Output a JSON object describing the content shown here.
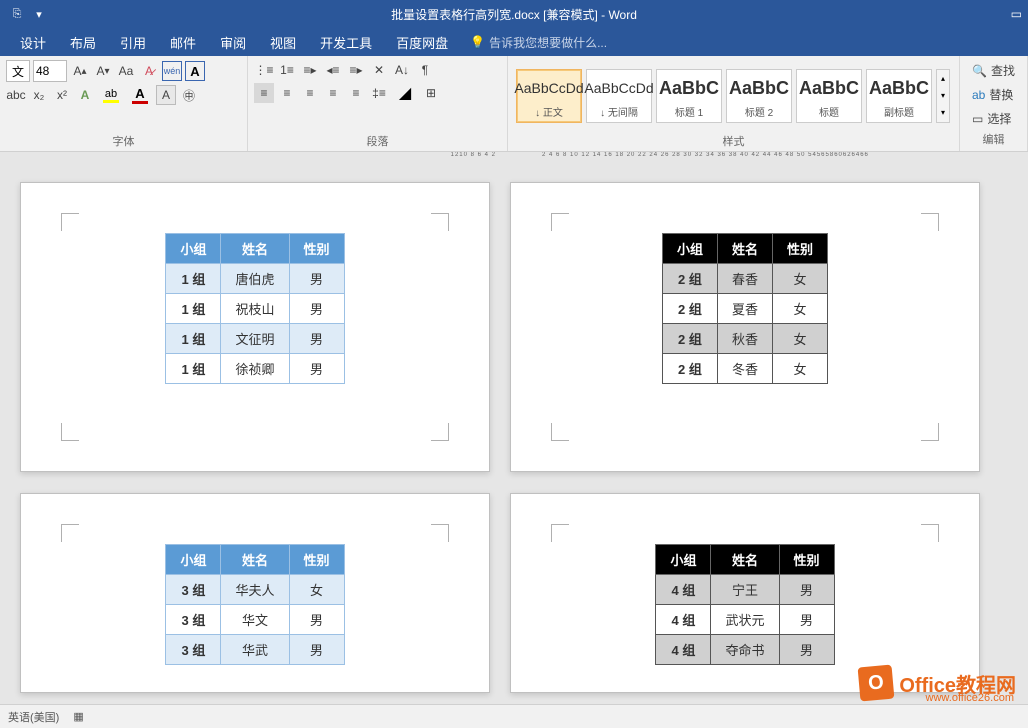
{
  "title": "批量设置表格行高列宽.docx [兼容模式] - Word",
  "tabs": [
    "设计",
    "布局",
    "引用",
    "邮件",
    "审阅",
    "视图",
    "开发工具",
    "百度网盘"
  ],
  "tellme": "告诉我您想要做什么...",
  "font_size": "48",
  "font_combo": "文",
  "groups": {
    "font": "字体",
    "paragraph": "段落",
    "styles": "样式",
    "editing": "编辑"
  },
  "styles": [
    {
      "preview": "AaBbCcDd",
      "name": "↓ 正文",
      "big": false,
      "sel": true
    },
    {
      "preview": "AaBbCcDd",
      "name": "↓ 无间隔",
      "big": false,
      "sel": false
    },
    {
      "preview": "AaBbC",
      "name": "标题 1",
      "big": true,
      "sel": false
    },
    {
      "preview": "AaBbC",
      "name": "标题 2",
      "big": true,
      "sel": false
    },
    {
      "preview": "AaBbC",
      "name": "标题",
      "big": true,
      "sel": false
    },
    {
      "preview": "AaBbC",
      "name": "副标题",
      "big": true,
      "sel": false
    }
  ],
  "edit_items": {
    "find": "查找",
    "replace": "替换",
    "select": "选择"
  },
  "table_headers": [
    "小组",
    "姓名",
    "性别"
  ],
  "table1": [
    [
      "1 组",
      "唐伯虎",
      "男"
    ],
    [
      "1 组",
      "祝枝山",
      "男"
    ],
    [
      "1 组",
      "文征明",
      "男"
    ],
    [
      "1 组",
      "徐祯卿",
      "男"
    ]
  ],
  "table2": [
    [
      "2 组",
      "春香",
      "女"
    ],
    [
      "2 组",
      "夏香",
      "女"
    ],
    [
      "2 组",
      "秋香",
      "女"
    ],
    [
      "2 组",
      "冬香",
      "女"
    ]
  ],
  "table3": [
    [
      "3 组",
      "华夫人",
      "女"
    ],
    [
      "3 组",
      "华文",
      "男"
    ],
    [
      "3 组",
      "华武",
      "男"
    ]
  ],
  "table4": [
    [
      "4 组",
      "宁王",
      "男"
    ],
    [
      "4 组",
      "武状元",
      "男"
    ],
    [
      "4 组",
      "夺命书",
      "男"
    ]
  ],
  "ruler_left": "1210 8 6 4 2",
  "ruler_right": "2 4 6 8 10 12 14 16 18 20 22 24 26 28 30 32 34 36 38 40 42 44 46 48 50   54565860626466",
  "status": {
    "lang": "英语(美国)"
  },
  "watermark": {
    "title": "Office教程网",
    "url": "www.office26.com"
  }
}
